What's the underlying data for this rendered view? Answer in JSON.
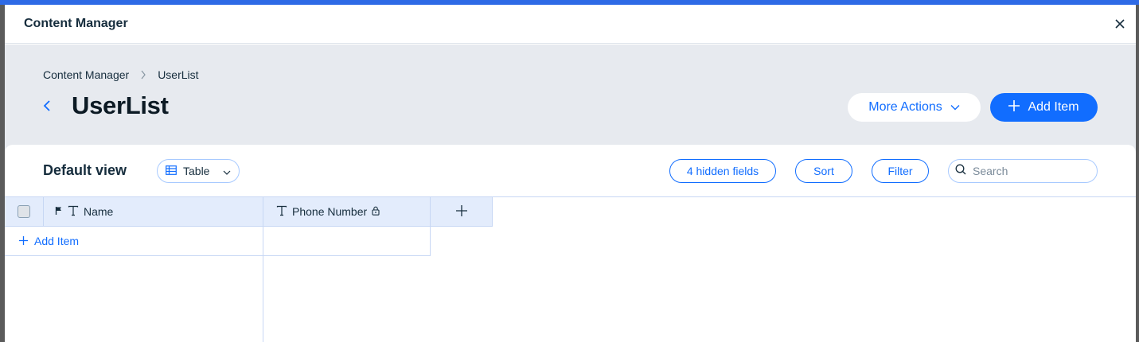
{
  "modal": {
    "title": "Content Manager"
  },
  "breadcrumb": {
    "parent": "Content Manager",
    "current": "UserList"
  },
  "page": {
    "title": "UserList"
  },
  "actions": {
    "more_label": "More Actions",
    "add_label": "Add Item"
  },
  "view": {
    "name": "Default view",
    "type": "Table",
    "hidden_fields": "4 hidden fields",
    "sort_label": "Sort",
    "filter_label": "Filter",
    "search_placeholder": "Search"
  },
  "table": {
    "columns": [
      {
        "label": "Name",
        "icons": [
          "flag-icon",
          "text-type-icon"
        ]
      },
      {
        "label": "Phone Number",
        "icons": [
          "text-type-icon",
          "lock-icon"
        ]
      }
    ],
    "add_item_label": "Add Item"
  },
  "colors": {
    "accent": "#116dff",
    "hero_bg": "#e7eaef",
    "header_cell_bg": "#e3ecfc",
    "topbar": "#2e6ae6"
  }
}
